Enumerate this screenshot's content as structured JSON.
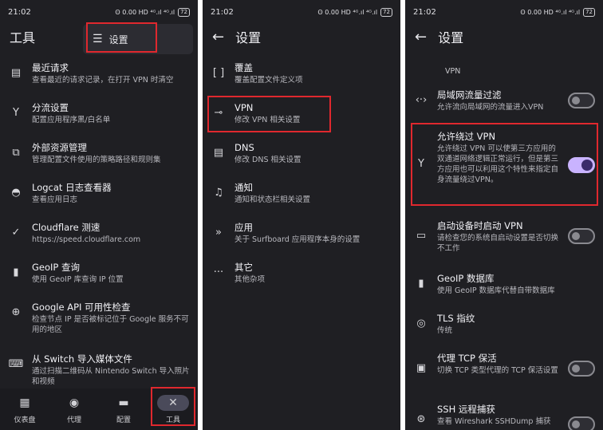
{
  "status": {
    "time": "21:02",
    "icons": "ʘ 0.00 HD ⁴ᴳ.ıl ⁴ᴳ.ıl",
    "battery": "72"
  },
  "panel1": {
    "title": "工具",
    "settings_popup": "设置",
    "items": [
      {
        "title": "最近请求",
        "sub": "查看最近的请求记录，在打开 VPN 时清空",
        "icon": "list-icon"
      },
      {
        "title": "分流设置",
        "sub": "配置应用程序黑/白名单",
        "icon": "fork-icon"
      },
      {
        "title": "外部资源管理",
        "sub": "管理配置文件使用的策略路径和规则集",
        "icon": "external-icon"
      },
      {
        "title": "Logcat 日志查看器",
        "sub": "查看应用日志",
        "icon": "android-icon"
      },
      {
        "title": "Cloudflare 测速",
        "sub": "https://speed.cloudflare.com",
        "icon": "speed-icon"
      },
      {
        "title": "GeoIP 查询",
        "sub": "使用 GeoIP 库查询 IP 位置",
        "icon": "map-icon"
      },
      {
        "title": "Google API 可用性检查",
        "sub": "检查节点 IP 是否被标记位于 Google 服务不可用的地区",
        "icon": "target-icon"
      },
      {
        "title": "从 Switch 导入媒体文件",
        "sub": "通过扫描二维码从 Nintendo Switch 导入照片和视频",
        "icon": "gamepad-icon"
      }
    ],
    "nav": [
      {
        "label": "仪表盘",
        "icon": "dashboard-icon"
      },
      {
        "label": "代理",
        "icon": "proxy-icon"
      },
      {
        "label": "配置",
        "icon": "folder-icon"
      },
      {
        "label": "工具",
        "icon": "tools-icon"
      }
    ]
  },
  "panel2": {
    "title": "设置",
    "items": [
      {
        "title": "覆盖",
        "sub": "覆盖配置文件定义项",
        "icon": "brackets-icon"
      },
      {
        "title": "VPN",
        "sub": "修改 VPN 相关设置",
        "icon": "key-icon"
      },
      {
        "title": "DNS",
        "sub": "修改 DNS 相关设置",
        "icon": "server-icon"
      },
      {
        "title": "通知",
        "sub": "通知和状态栏相关设置",
        "icon": "bell-icon"
      },
      {
        "title": "应用",
        "sub": "关于 Surfboard 应用程序本身的设置",
        "icon": "chevrons-icon"
      },
      {
        "title": "其它",
        "sub": "其他杂项",
        "icon": "more-icon"
      }
    ]
  },
  "panel3": {
    "title": "设置",
    "section": "VPN",
    "items": [
      {
        "title": "局域网流量过滤",
        "sub": "允许流向局域网的流量进入VPN",
        "toggle": "off",
        "icon": "code-icon"
      },
      {
        "title": "允许绕过 VPN",
        "sub": "允许绕过 VPN 可以使第三方应用的双通道网络逻辑正常运行，但是第三方应用也可以利用这个特性来指定自身流量绕过VPN。",
        "toggle": "on",
        "icon": "fork-icon"
      },
      {
        "title": "启动设备时启动 VPN",
        "sub": "请检查您的系统自启动设置是否切换不工作",
        "toggle": "off",
        "icon": "devices-icon"
      },
      {
        "title": "GeoIP 数据库",
        "sub": "使用 GeoIP 数据库代替自带数据库",
        "icon": "map-icon"
      },
      {
        "title": "TLS 指纹",
        "sub": "传统",
        "icon": "fingerprint-icon"
      },
      {
        "title": "代理 TCP 保活",
        "sub": "切换 TCP 类型代理的 TCP 保活设置",
        "toggle": "off",
        "icon": "pulse-icon"
      },
      {
        "title": "SSH 远程捕获",
        "sub": "查看 Wireshark SSHDump 捕获",
        "toggle": "off",
        "icon": "shark-icon"
      }
    ]
  }
}
